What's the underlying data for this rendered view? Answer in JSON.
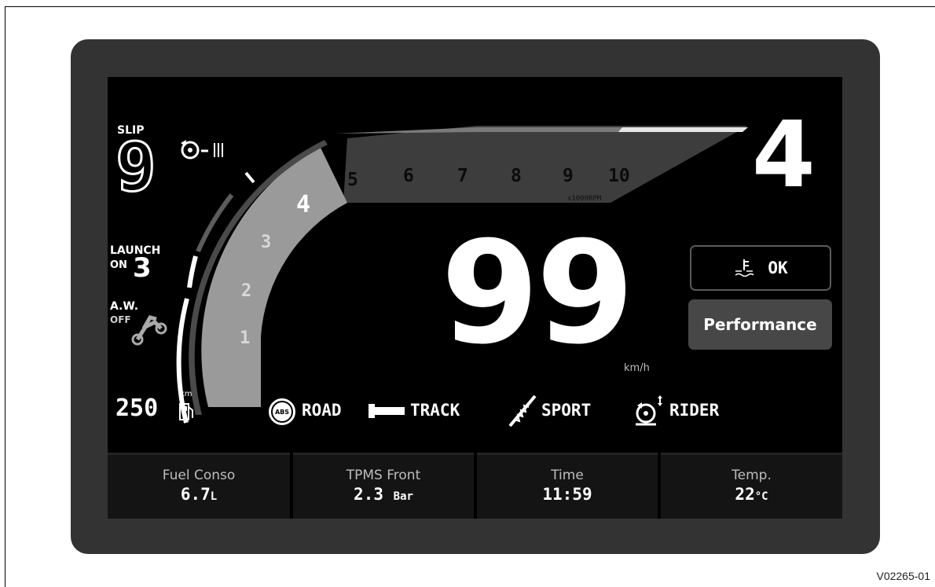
{
  "reference_code": "V02265-01",
  "left_panel": {
    "slip_label": "SLIP",
    "slip_level": "9",
    "launch_label": "LAUNCH",
    "launch_state": "ON",
    "launch_level": "3",
    "aw_label": "A.W.",
    "aw_state": "OFF",
    "range_value": "250",
    "range_unit": "km"
  },
  "tachometer": {
    "scale_labels": [
      "1",
      "2",
      "3",
      "4",
      "5",
      "6",
      "7",
      "8",
      "9",
      "10"
    ],
    "unit": "x1000RPM",
    "current_rpm_x1000": 4.6
  },
  "gear": "4",
  "speed": {
    "value": "99",
    "unit": "km/h"
  },
  "engine_temp_status": {
    "icon": "coolant-temp-icon",
    "label": "OK"
  },
  "ride_mode_button": {
    "label": "Performance"
  },
  "modes": {
    "abs_badge": "ABS",
    "abs_mode": "ROAD",
    "engine_mode": "TRACK",
    "suspension_mode": "SPORT",
    "rider_mode": "RIDER"
  },
  "info_tiles": [
    {
      "label": "Fuel Conso",
      "value": "6.7",
      "unit": "L"
    },
    {
      "label": "TPMS Front",
      "value": "2.3",
      "unit": "Bar"
    },
    {
      "label": "Time",
      "value": "11:59",
      "unit": ""
    },
    {
      "label": "Temp.",
      "value": "22",
      "unit": "°C"
    }
  ],
  "colors": {
    "bezel": "#333333",
    "screen": "#000000",
    "tach_filled": "#9a9a9a",
    "tach_unfilled": "#3d3d3d",
    "button_bg": "#474747"
  }
}
